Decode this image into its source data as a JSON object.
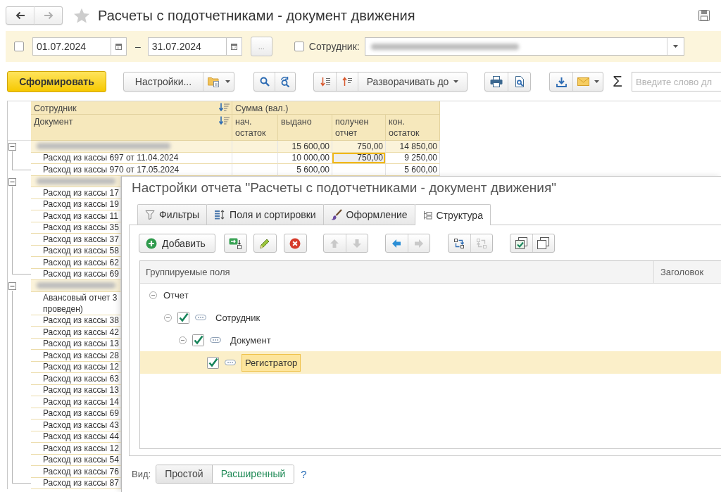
{
  "window": {
    "title": "Расчеты с подотчетниками - документ движения"
  },
  "navigation": {
    "back": {
      "disabled": false
    },
    "forward": {
      "disabled": true
    }
  },
  "period": {
    "enabled": false,
    "start": "01.07.2024",
    "separator": "–",
    "end": "31.07.2024",
    "more": "..."
  },
  "employee_filter": {
    "enabled": false,
    "label": "Сотрудник:"
  },
  "toolbar": {
    "generate": "Сформировать",
    "settings": "Настройки...",
    "expand_to": "Разворачивать до",
    "sum": "Σ",
    "search": {
      "placeholder": "Введите слово дл"
    }
  },
  "report": {
    "columns": {
      "group": "Сотрудник",
      "document": "Документ",
      "amount": "Сумма (вал.)",
      "amount_parts": [
        "нач.\nостаток",
        "выдано",
        "получен\nотчет",
        "кон.\nостаток"
      ]
    },
    "groups": [
      {
        "expanded": true,
        "cells": [
          {
            "selected": false
          },
          {
            "text": "15 600,00",
            "selected": false
          },
          {
            "text": "750,00",
            "selected": false
          },
          {
            "text": "14 850,00",
            "selected": false
          }
        ],
        "rows": [
          {
            "document": "Расход из кассы 697 от 11.04.2024",
            "cells": [
              {
                "selected": false
              },
              {
                "text": "10 000,00",
                "selected": false
              },
              {
                "text": "750,00",
                "selected": true
              },
              {
                "text": "9 250,00",
                "selected": false
              }
            ]
          },
          {
            "document": "Расход из кассы 970 от 17.05.2024",
            "cells": [
              {
                "selected": false
              },
              {
                "text": "5 600,00",
                "selected": false
              },
              {
                "selected": false
              },
              {
                "text": "5 600,00",
                "selected": false
              }
            ]
          }
        ]
      },
      {
        "expanded": true,
        "rows": [
          {
            "document": "Расход из кассы 17"
          },
          {
            "document": "Расход из кассы 19"
          },
          {
            "document": "Расход из кассы 11"
          },
          {
            "document": "Расход из кассы 35"
          },
          {
            "document": "Расход из кассы 37"
          },
          {
            "document": "Расход из кассы 58"
          },
          {
            "document": "Расход из кассы 62"
          },
          {
            "document": "Расход из кассы 69"
          }
        ]
      },
      {
        "expanded": true,
        "rows": [
          {
            "document": "Авансовый отчет 3\nпроведен)"
          },
          {
            "document": "Расход из кассы 38"
          },
          {
            "document": "Расход из кассы 42"
          },
          {
            "document": "Расход из кассы 13"
          },
          {
            "document": "Расход из кассы 28"
          },
          {
            "document": "Расход из кассы 12"
          },
          {
            "document": "Расход из кассы 63"
          },
          {
            "document": "Расход из кассы 13"
          },
          {
            "document": "Расход из кассы 14"
          },
          {
            "document": "Расход из кассы 69"
          },
          {
            "document": "Расход из кассы 43"
          },
          {
            "document": "Расход из кассы 44"
          },
          {
            "document": "Расход из кассы 12"
          },
          {
            "document": "Расход из кассы 54"
          },
          {
            "document": "Расход из кассы 76"
          },
          {
            "document": "Расход из кассы 87"
          }
        ]
      }
    ]
  },
  "dialog": {
    "title": "Настройки отчета \"Расчеты с подотчетниками - документ движения\"",
    "tabs": [
      {
        "kind": "filter",
        "label": "Фильтры",
        "selected": false
      },
      {
        "kind": "fields",
        "label": "Поля и сортировки",
        "selected": false
      },
      {
        "kind": "appearance",
        "label": "Оформление",
        "selected": false
      },
      {
        "kind": "structure",
        "label": "Структура",
        "selected": true
      }
    ],
    "toolbar": {
      "add": "Добавить",
      "groups": [
        {
          "buttons": [
            {
              "kind": "add-grouping",
              "disabled": false
            }
          ]
        },
        {
          "buttons": [
            {
              "kind": "edit",
              "disabled": false
            }
          ]
        },
        {
          "buttons": [
            {
              "kind": "delete",
              "disabled": false
            }
          ]
        },
        {
          "buttons": [
            {
              "kind": "move-up",
              "disabled": true
            },
            {
              "kind": "move-down",
              "disabled": true
            }
          ]
        },
        {
          "buttons": [
            {
              "kind": "level-up",
              "disabled": false
            },
            {
              "kind": "level-down",
              "disabled": true
            }
          ]
        },
        {
          "buttons": [
            {
              "kind": "group",
              "disabled": false
            },
            {
              "kind": "ungroup",
              "disabled": true
            }
          ]
        },
        {
          "buttons": [
            {
              "kind": "check-all",
              "disabled": false
            },
            {
              "kind": "uncheck-all",
              "disabled": false
            }
          ]
        }
      ]
    },
    "columns": [
      "Группируемые поля",
      "Заголовок"
    ],
    "tree": [
      {
        "kind": "root",
        "label": "Отчет",
        "expanded": true,
        "selected": false,
        "children": [
          {
            "kind": "grouping",
            "label": "Сотрудник",
            "checked": true,
            "expanded": true,
            "selected": false,
            "children": [
              {
                "kind": "grouping",
                "label": "Документ",
                "checked": true,
                "expanded": true,
                "selected": false,
                "children": [
                  {
                    "kind": "grouping",
                    "label": "Регистратор",
                    "checked": true,
                    "selected": true
                  }
                ]
              }
            ]
          }
        ]
      }
    ],
    "view": {
      "label": "Вид:",
      "options": [
        {
          "label": "Простой",
          "selected": false
        },
        {
          "label": "Расширенный",
          "selected": true
        }
      ],
      "help": "?"
    }
  }
}
